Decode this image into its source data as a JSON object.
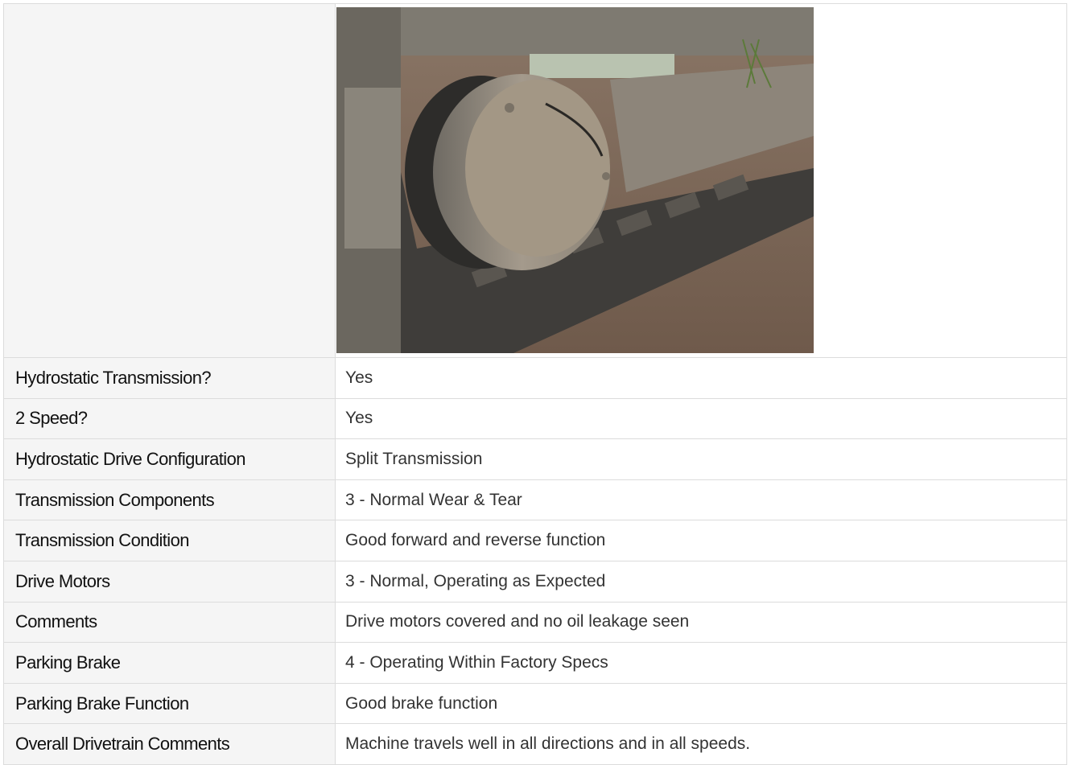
{
  "photo": {
    "alt": "Excavator track drive motor and undercarriage"
  },
  "rows": [
    {
      "label": "Hydrostatic Transmission?",
      "value": "Yes"
    },
    {
      "label": "2 Speed?",
      "value": "Yes"
    },
    {
      "label": "Hydrostatic Drive Configuration",
      "value": "Split Transmission"
    },
    {
      "label": "Transmission Components",
      "value": "3 - Normal Wear & Tear"
    },
    {
      "label": "Transmission Condition",
      "value": "Good forward and reverse function"
    },
    {
      "label": "Drive Motors",
      "value": "3 - Normal, Operating as Expected"
    },
    {
      "label": "Comments",
      "value": "Drive motors covered and no oil leakage seen"
    },
    {
      "label": "Parking Brake",
      "value": "4 - Operating Within Factory Specs"
    },
    {
      "label": "Parking Brake Function",
      "value": "Good brake function"
    },
    {
      "label": "Overall Drivetrain Comments",
      "value": "Machine travels well in all directions and in all speeds."
    }
  ]
}
